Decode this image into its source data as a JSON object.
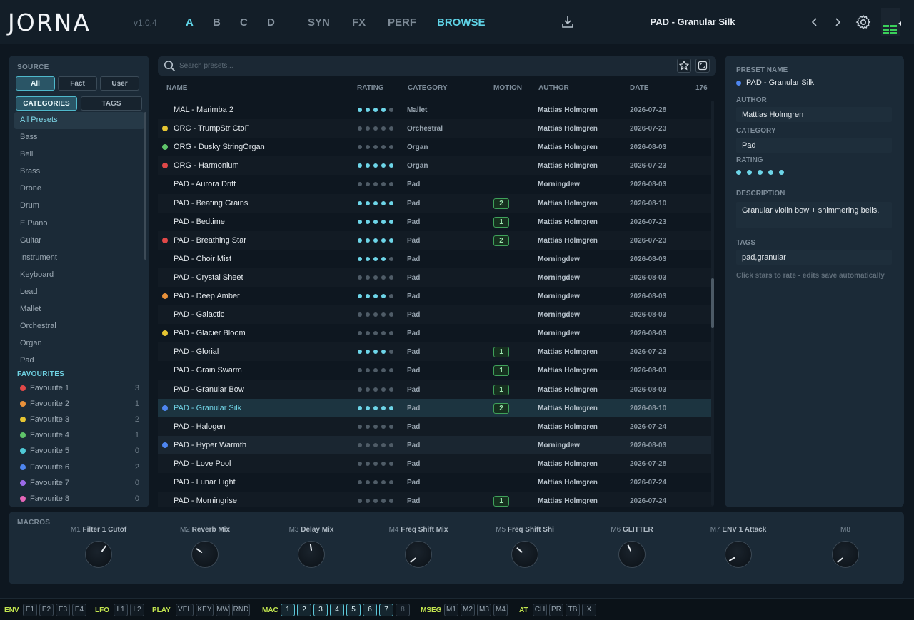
{
  "header": {
    "logo": "JORNA",
    "version": "v1.0.4",
    "slots": [
      "A",
      "B",
      "C",
      "D"
    ],
    "active_slot": "A",
    "nav_tabs": [
      "SYN",
      "FX",
      "PERF",
      "BROWSE"
    ],
    "active_tab": "BROWSE",
    "current_preset": "PAD - Granular Silk",
    "icons": {
      "save": "download-icon",
      "prev": "chevron-left-icon",
      "next": "chevron-right-icon",
      "settings": "gear-icon"
    }
  },
  "sidebar": {
    "source_label": "SOURCE",
    "source_options": [
      "All",
      "Fact",
      "User"
    ],
    "source_selected": "All",
    "view_tabs": [
      "CATEGORIES",
      "TAGS"
    ],
    "view_selected": "CATEGORIES",
    "categories": [
      "All Presets",
      "Bass",
      "Bell",
      "Brass",
      "Drone",
      "Drum",
      "E Piano",
      "Guitar",
      "Instrument",
      "Keyboard",
      "Lead",
      "Mallet",
      "Orchestral",
      "Organ",
      "Pad"
    ],
    "category_selected": "All Presets",
    "favourites_label": "FAVOURITES",
    "favourites": [
      {
        "name": "Favourite 1",
        "count": "3",
        "color": "#e04848"
      },
      {
        "name": "Favourite 2",
        "count": "1",
        "color": "#e8913a"
      },
      {
        "name": "Favourite 3",
        "count": "2",
        "color": "#e6c532"
      },
      {
        "name": "Favourite 4",
        "count": "1",
        "color": "#5fc46a"
      },
      {
        "name": "Favourite 5",
        "count": "0",
        "color": "#4fc9d6"
      },
      {
        "name": "Favourite 6",
        "count": "2",
        "color": "#4e86f0"
      },
      {
        "name": "Favourite 7",
        "count": "0",
        "color": "#9b6ae8"
      },
      {
        "name": "Favourite 8",
        "count": "0",
        "color": "#e466b8"
      }
    ]
  },
  "browser": {
    "search_placeholder": "Search presets...",
    "columns": {
      "name": "NAME",
      "rating": "RATING",
      "category": "CATEGORY",
      "motion": "MOTION",
      "author": "AUTHOR",
      "date": "DATE",
      "count": "176"
    },
    "rows": [
      {
        "name": "MAL - Marimba 2",
        "color": "",
        "rating": 4,
        "category": "Mallet",
        "motion": "",
        "author": "Mattias Holmgren",
        "date": "2026-07-28"
      },
      {
        "name": "ORC - TrumpStr CtoF",
        "color": "#e6c532",
        "rating": 0,
        "category": "Orchestral",
        "motion": "",
        "author": "Mattias Holmgren",
        "date": "2026-07-23"
      },
      {
        "name": "ORG - Dusky StringOrgan",
        "color": "#5fc46a",
        "rating": 0,
        "category": "Organ",
        "motion": "",
        "author": "Mattias Holmgren",
        "date": "2026-08-03"
      },
      {
        "name": "ORG - Harmonium",
        "color": "#e04848",
        "rating": 5,
        "category": "Organ",
        "motion": "",
        "author": "Mattias Holmgren",
        "date": "2026-07-23"
      },
      {
        "name": "PAD - Aurora Drift",
        "color": "",
        "rating": 0,
        "category": "Pad",
        "motion": "",
        "author": "Morningdew",
        "date": "2026-08-03"
      },
      {
        "name": "PAD - Beating Grains",
        "color": "",
        "rating": 5,
        "category": "Pad",
        "motion": "2",
        "author": "Mattias Holmgren",
        "date": "2026-08-10"
      },
      {
        "name": "PAD - Bedtime",
        "color": "",
        "rating": 5,
        "category": "Pad",
        "motion": "1",
        "author": "Mattias Holmgren",
        "date": "2026-07-23"
      },
      {
        "name": "PAD - Breathing Star",
        "color": "#e04848",
        "rating": 5,
        "category": "Pad",
        "motion": "2",
        "author": "Mattias Holmgren",
        "date": "2026-07-23"
      },
      {
        "name": "PAD - Choir Mist",
        "color": "",
        "rating": 4,
        "category": "Pad",
        "motion": "",
        "author": "Morningdew",
        "date": "2026-08-03"
      },
      {
        "name": "PAD - Crystal Sheet",
        "color": "",
        "rating": 0,
        "category": "Pad",
        "motion": "",
        "author": "Morningdew",
        "date": "2026-08-03"
      },
      {
        "name": "PAD - Deep Amber",
        "color": "#e8913a",
        "rating": 4,
        "category": "Pad",
        "motion": "",
        "author": "Morningdew",
        "date": "2026-08-03"
      },
      {
        "name": "PAD - Galactic",
        "color": "",
        "rating": 0,
        "category": "Pad",
        "motion": "",
        "author": "Morningdew",
        "date": "2026-08-03"
      },
      {
        "name": "PAD - Glacier Bloom",
        "color": "#e6c532",
        "rating": 0,
        "category": "Pad",
        "motion": "",
        "author": "Morningdew",
        "date": "2026-08-03"
      },
      {
        "name": "PAD - Glorial",
        "color": "",
        "rating": 4,
        "category": "Pad",
        "motion": "1",
        "author": "Mattias Holmgren",
        "date": "2026-07-23"
      },
      {
        "name": "PAD - Grain Swarm",
        "color": "",
        "rating": 0,
        "category": "Pad",
        "motion": "1",
        "author": "Mattias Holmgren",
        "date": "2026-08-03"
      },
      {
        "name": "PAD - Granular Bow",
        "color": "",
        "rating": 0,
        "category": "Pad",
        "motion": "1",
        "author": "Mattias Holmgren",
        "date": "2026-08-03"
      },
      {
        "name": "PAD - Granular Silk",
        "color": "#4e86f0",
        "rating": 5,
        "category": "Pad",
        "motion": "2",
        "author": "Mattias Holmgren",
        "date": "2026-08-10",
        "selected": true
      },
      {
        "name": "PAD - Halogen",
        "color": "",
        "rating": 0,
        "category": "Pad",
        "motion": "",
        "author": "Mattias Holmgren",
        "date": "2026-07-24"
      },
      {
        "name": "PAD - Hyper Warmth",
        "color": "#4e86f0",
        "rating": 0,
        "category": "Pad",
        "motion": "",
        "author": "Morningdew",
        "date": "2026-08-03"
      },
      {
        "name": "PAD - Love Pool",
        "color": "",
        "rating": 0,
        "category": "Pad",
        "motion": "",
        "author": "Mattias Holmgren",
        "date": "2026-07-28"
      },
      {
        "name": "PAD - Lunar Light",
        "color": "",
        "rating": 0,
        "category": "Pad",
        "motion": "",
        "author": "Mattias Holmgren",
        "date": "2026-07-24"
      },
      {
        "name": "PAD - Morningrise",
        "color": "",
        "rating": 0,
        "category": "Pad",
        "motion": "1",
        "author": "Mattias Holmgren",
        "date": "2026-07-24"
      }
    ]
  },
  "info": {
    "preset_name_label": "PRESET NAME",
    "preset_name": "PAD - Granular Silk",
    "preset_color": "#4e86f0",
    "author_label": "AUTHOR",
    "author": "Mattias Holmgren",
    "category_label": "CATEGORY",
    "category": "Pad",
    "rating_label": "RATING",
    "rating": 5,
    "description_label": "DESCRIPTION",
    "description": "Granular violin bow + shimmering bells.",
    "tags_label": "TAGS",
    "tags": "pad,granular",
    "hint": "Click stars to rate - edits save automatically"
  },
  "macros": {
    "label": "MACROS",
    "items": [
      {
        "id": "M1",
        "name": "Filter 1 Cutof",
        "angle": 35
      },
      {
        "id": "M2",
        "name": "Reverb Mix",
        "angle": -55
      },
      {
        "id": "M3",
        "name": "Delay Mix",
        "angle": -8
      },
      {
        "id": "M4",
        "name": "Freq Shift Mix",
        "angle": -130
      },
      {
        "id": "M5",
        "name": "Freq Shift Shi",
        "angle": -50
      },
      {
        "id": "M6",
        "name": "GLITTER",
        "angle": -25
      },
      {
        "id": "M7",
        "name": "ENV 1 Attack",
        "angle": -120
      },
      {
        "id": "M8",
        "name": "",
        "angle": -130
      }
    ]
  },
  "bottombar": {
    "groups": [
      {
        "label": "ENV",
        "buttons": [
          "E1",
          "E2",
          "E3",
          "E4"
        ]
      },
      {
        "label": "LFO",
        "buttons": [
          "L1",
          "L2"
        ]
      },
      {
        "label": "PLAY",
        "buttons": [
          "VEL",
          "KEY",
          "MW",
          "RND"
        ]
      },
      {
        "label": "MAC",
        "buttons": [
          "1",
          "2",
          "3",
          "4",
          "5",
          "6",
          "7",
          "8"
        ]
      },
      {
        "label": "MSEG",
        "buttons": [
          "M1",
          "M2",
          "M3",
          "M4"
        ]
      },
      {
        "label": "AT",
        "buttons": [
          "CH",
          "PR",
          "TB",
          "X"
        ]
      }
    ]
  }
}
